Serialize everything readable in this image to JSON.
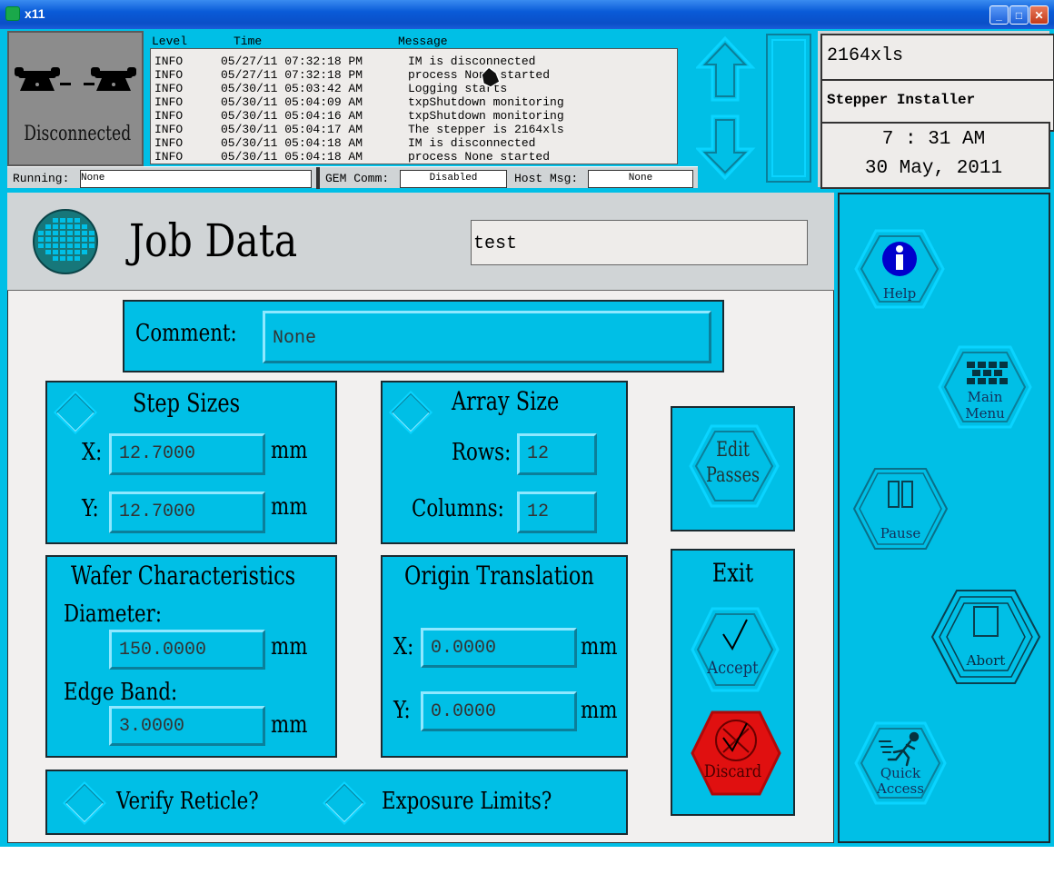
{
  "window": {
    "title": "x11"
  },
  "connection": {
    "status": "Disconnected"
  },
  "log": {
    "headers": {
      "level": "Level",
      "time": "Time",
      "message": "Message"
    },
    "rows": [
      {
        "level": "INFO",
        "time": "05/27/11 07:32:18 PM",
        "message": "IM is disconnected"
      },
      {
        "level": "INFO",
        "time": "05/27/11 07:32:18 PM",
        "message": "process None started"
      },
      {
        "level": "INFO",
        "time": "05/30/11 05:03:42 AM",
        "message": "Logging starts"
      },
      {
        "level": "INFO",
        "time": "05/30/11 05:04:09 AM",
        "message": "txpShutdown monitoring"
      },
      {
        "level": "INFO",
        "time": "05/30/11 05:04:16 AM",
        "message": "txpShutdown monitoring"
      },
      {
        "level": "INFO",
        "time": "05/30/11 05:04:17 AM",
        "message": "The stepper is 2164xls"
      },
      {
        "level": "INFO",
        "time": "05/30/11 05:04:18 AM",
        "message": "IM is disconnected"
      },
      {
        "level": "INFO",
        "time": "05/30/11 05:04:18 AM",
        "message": "process None started"
      }
    ]
  },
  "status": {
    "running_label": "Running:",
    "running_value": "None",
    "gem_label": "GEM Comm:",
    "gem_value": "Disabled",
    "host_label": "Host Msg:",
    "host_value": "None"
  },
  "info": {
    "machine": "2164xls",
    "mode": "Stepper Installer",
    "time": "7 : 31  AM",
    "date": "30 May, 2011"
  },
  "job": {
    "title": "Job Data",
    "name": "test",
    "comment_label": "Comment:",
    "comment_value": "None"
  },
  "step_sizes": {
    "title": "Step Sizes",
    "x_label": "X:",
    "x_value": "12.7000",
    "y_label": "Y:",
    "y_value": "12.7000",
    "unit": "mm"
  },
  "array_size": {
    "title": "Array Size",
    "rows_label": "Rows:",
    "rows_value": "12",
    "cols_label": "Columns:",
    "cols_value": "12"
  },
  "wafer": {
    "title": "Wafer Characteristics",
    "diameter_label": "Diameter:",
    "diameter_value": "150.0000",
    "edge_label": "Edge Band:",
    "edge_value": "3.0000",
    "unit": "mm"
  },
  "origin": {
    "title": "Origin Translation",
    "x_label": "X:",
    "x_value": "0.0000",
    "y_label": "Y:",
    "y_value": "0.0000",
    "unit": "mm"
  },
  "options": {
    "verify": "Verify Reticle?",
    "exposure": "Exposure Limits?"
  },
  "actions": {
    "edit_line1": "Edit",
    "edit_line2": "Passes",
    "exit": "Exit",
    "accept": "Accept",
    "discard": "Discard"
  },
  "side": {
    "help": "Help",
    "main_line1": "Main",
    "main_line2": "Menu",
    "pause": "Pause",
    "abort": "Abort",
    "quick_line1": "Quick",
    "quick_line2": "Access"
  },
  "colors": {
    "panel": "#00bfe6",
    "discard": "#e01010",
    "titlebar": "#0a5bd8"
  }
}
